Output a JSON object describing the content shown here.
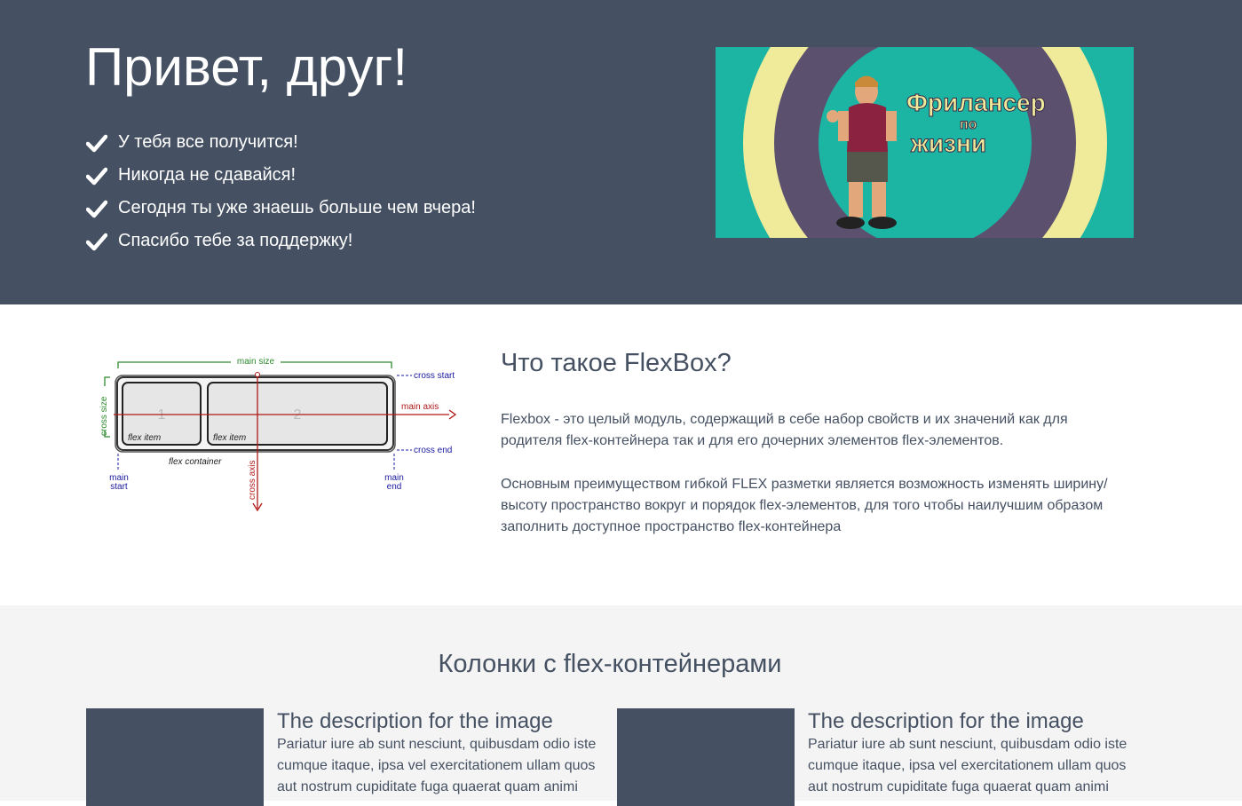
{
  "hero": {
    "title": "Привет, друг!",
    "items": [
      "У тебя все получится!",
      "Никогда не сдавайся!",
      "Сегодня ты уже знаешь больше чем вчера!",
      "Спасибо тебе за поддержку!"
    ],
    "image_caption": [
      "Фрилансер",
      "по",
      "жизни"
    ]
  },
  "flexbox": {
    "title": "Что такое FlexBox?",
    "p1": "Flexbox - это целый модуль, содержащий в себе набор свойств и их значений как для родителя flex-контейнера так и для его дочерних элементов flex-элементов.",
    "p2": "Основным преимуществом гибкой FLEX разметки является возможность изменять ширину/высоту пространство вокруг и порядок flex-элементов, для того чтобы наилучшим образом заполнить доступное пространство flex-контейнера",
    "diagram": {
      "main_size": "main size",
      "cross_start": "cross start",
      "cross_end": "cross end",
      "main_axis": "main axis",
      "cross_size": "cross size",
      "cross_axis": "cross axis",
      "item1_num": "1",
      "item2_num": "2",
      "flex_item": "flex item",
      "flex_container": "flex container",
      "main": "main",
      "start": "start",
      "end": "end"
    }
  },
  "columns": {
    "title": "Колонки с flex-контейнерами",
    "cards": [
      {
        "heading": "The description for the image",
        "lines": [
          "Pariatur iure ab sunt nesciunt, quibusdam odio iste",
          "cumque itaque, ipsa vel exercitationem ullam quos",
          "aut nostrum cupiditate fuga quaerat quam animi"
        ]
      },
      {
        "heading": "The description for the image",
        "lines": [
          "Pariatur iure ab sunt nesciunt, quibusdam odio iste",
          "cumque itaque, ipsa vel exercitationem ullam quos",
          "aut nostrum cupiditate fuga quaerat quam animi"
        ]
      }
    ]
  },
  "colors": {
    "dark": "#455162",
    "light_bg": "#f4f4f4",
    "diagram_green": "#2e8b2e",
    "diagram_red": "#b01818",
    "diagram_blue": "#1a1aa0"
  }
}
